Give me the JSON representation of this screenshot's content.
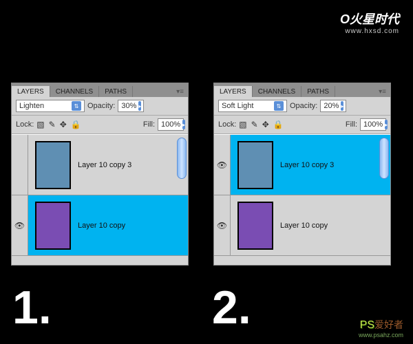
{
  "watermarks": {
    "top_brand": "火星时代",
    "top_prefix": "O",
    "top_url": "www.hxsd.com",
    "bottom_ps": "PS",
    "bottom_cn": "爱好者",
    "bottom_url": "www.psahz.com"
  },
  "labels": {
    "number1": "1.",
    "number2": "2."
  },
  "tabs": [
    "LAYERS",
    "CHANNELS",
    "PATHS"
  ],
  "panels": [
    {
      "blend_mode": "Lighten",
      "opacity_label": "Opacity:",
      "opacity_value": "30%",
      "lock_label": "Lock:",
      "fill_label": "Fill:",
      "fill_value": "100%",
      "layers": [
        {
          "name": "Layer 10 copy 3",
          "color": "blue",
          "selected": false,
          "visible": false
        },
        {
          "name": "Layer 10 copy",
          "color": "purple",
          "selected": true,
          "visible": true
        }
      ]
    },
    {
      "blend_mode": "Soft Light",
      "opacity_label": "Opacity:",
      "opacity_value": "20%",
      "lock_label": "Lock:",
      "fill_label": "Fill:",
      "fill_value": "100%",
      "layers": [
        {
          "name": "Layer 10 copy 3",
          "color": "blue",
          "selected": true,
          "visible": true
        },
        {
          "name": "Layer 10 copy",
          "color": "purple",
          "selected": false,
          "visible": true
        }
      ]
    }
  ]
}
